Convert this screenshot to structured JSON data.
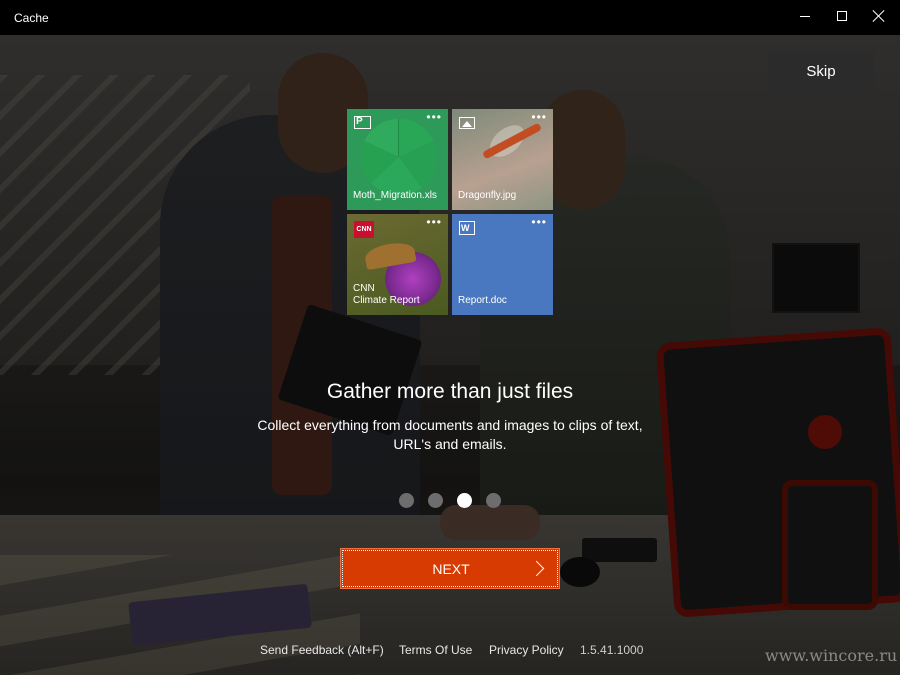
{
  "window": {
    "title": "Cache",
    "minimize_icon": "minimize-icon",
    "maximize_icon": "maximize-icon",
    "close_icon": "close-icon"
  },
  "skip_label": "Skip",
  "tiles": [
    {
      "name": "Moth_Migration.xls",
      "icon": "powerpoint-icon",
      "color": "#2e9a5a"
    },
    {
      "name": "Dragonfly.jpg",
      "icon": "image-icon"
    },
    {
      "name": "CNN",
      "subtitle": "Climate Report",
      "icon": "cnn-logo"
    },
    {
      "name": "Report.doc",
      "icon": "word-icon",
      "color": "#4a78c0"
    }
  ],
  "tile_menu": "•••",
  "headline": "Gather more than just files",
  "subline": "Collect everything from documents and images to clips of text, URL's and emails.",
  "pager": {
    "count": 4,
    "active_index": 2
  },
  "next_label": "NEXT",
  "accent": "#d83b01",
  "footer": {
    "feedback": "Send Feedback (Alt+F)",
    "terms": "Terms Of Use",
    "privacy": "Privacy Policy",
    "version": "1.5.41.1000"
  },
  "watermark": "www.wincore.ru"
}
